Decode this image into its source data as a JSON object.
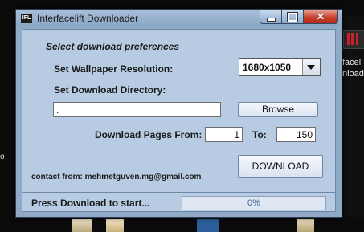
{
  "window": {
    "title": "Interfacelift Downloader",
    "icon_text": "IFL",
    "controls": {
      "minimize": "minimize-icon",
      "maximize": "maximize-icon",
      "close": "close-icon"
    }
  },
  "prefs": {
    "heading": "Select download preferences",
    "resolution_label": "Set Wallpaper Resolution:",
    "resolution_value": "1680x1050",
    "directory_label": "Set Download Directory:",
    "directory_value": ".",
    "browse_label": "Browse",
    "pages_label": "Download Pages From:",
    "pages_from": "1",
    "to_label": "To:",
    "pages_to": "150"
  },
  "contact": "contact from: mehmetguven.mg@gmail.com",
  "download_label": "DOWNLOAD",
  "status": {
    "text": "Press Download to start...",
    "progress_text": "0%",
    "progress_value": 0
  },
  "background": {
    "right_text_1": "facel",
    "right_text_2": "nload",
    "left_char": "o"
  },
  "colors": {
    "window_bg": "#8fa9c7",
    "panel_bg": "#b7cbe2",
    "close_button": "#c7412c"
  }
}
